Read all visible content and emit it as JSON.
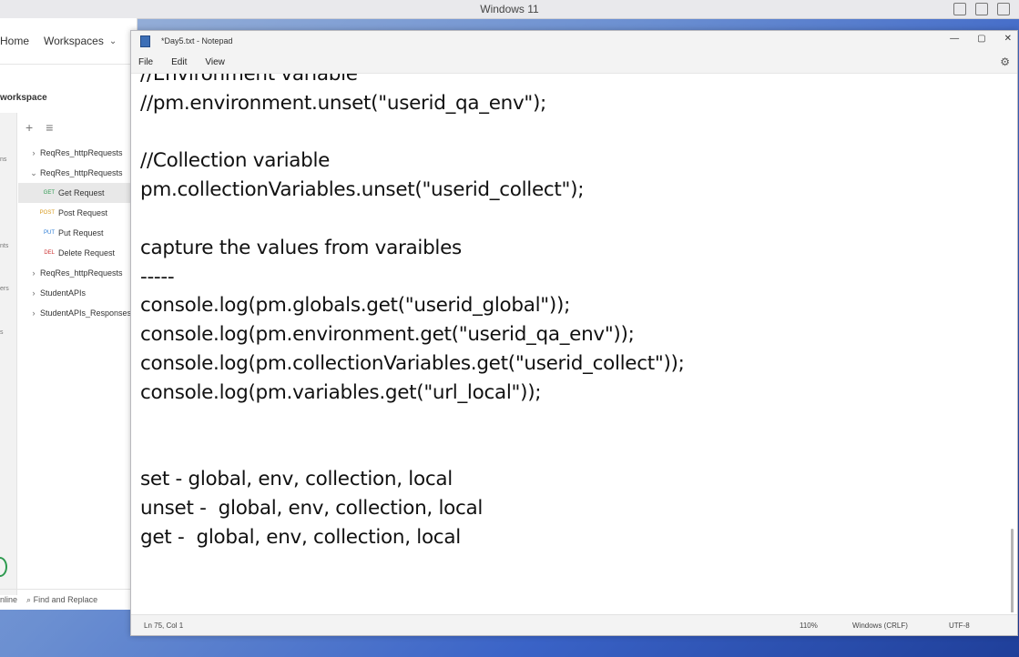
{
  "host": {
    "title": "Windows 11"
  },
  "postman": {
    "nav": {
      "home": "Home",
      "workspaces": "Workspaces"
    },
    "workspace_title": "workspace",
    "leftbar_labels": [
      "ns",
      "nts",
      "ers",
      "s"
    ],
    "tree": [
      {
        "type": "folder",
        "label": "ReqRes_httpRequests",
        "expanded": false
      },
      {
        "type": "folder",
        "label": "ReqRes_httpRequests",
        "expanded": true
      },
      {
        "type": "request",
        "method": "GET",
        "label": "Get Request",
        "selected": true
      },
      {
        "type": "request",
        "method": "POST",
        "label": "Post Request"
      },
      {
        "type": "request",
        "method": "PUT",
        "label": "Put Request"
      },
      {
        "type": "request",
        "method": "DEL",
        "label": "Delete Request"
      },
      {
        "type": "folder",
        "label": "ReqRes_httpRequests",
        "expanded": false
      },
      {
        "type": "folder",
        "label": "StudentAPIs",
        "expanded": false
      },
      {
        "type": "folder",
        "label": "StudentAPIs_Responses",
        "expanded": false
      }
    ],
    "footer": {
      "online": "nline",
      "find": "Find and Replace"
    }
  },
  "notepad": {
    "title": "*Day5.txt - Notepad",
    "menu": [
      "File",
      "Edit",
      "View"
    ],
    "lines": [
      "//Environment variable",
      "//pm.environment.unset(\"userid_qa_env\");",
      "",
      "//Collection variable",
      "pm.collectionVariables.unset(\"userid_collect\");",
      "",
      "capture the values from varaibles",
      "-----",
      "console.log(pm.globals.get(\"userid_global\"));",
      "console.log(pm.environment.get(\"userid_qa_env\"));",
      "console.log(pm.collectionVariables.get(\"userid_collect\"));",
      "console.log(pm.variables.get(\"url_local\"));",
      "",
      "",
      "set - global, env, collection, local",
      "unset -  global, env, collection, local",
      "get -  global, env, collection, local"
    ],
    "status": {
      "position": "Ln 75, Col 1",
      "zoom": "110%",
      "line_ending": "Windows (CRLF)",
      "encoding": "UTF-8"
    }
  }
}
